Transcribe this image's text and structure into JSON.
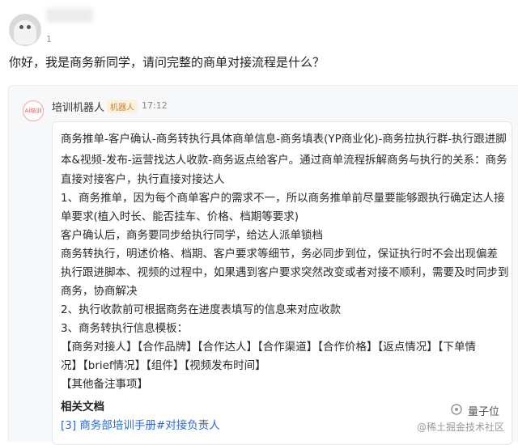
{
  "user_message": {
    "time": "1",
    "text": "你好，我是商务新同学，请问完整的商单对接流程是什么？"
  },
  "bot": {
    "avatar_text": "Ai培训",
    "name": "培训机器人",
    "tag": "机器人",
    "time": "17:12",
    "lines": [
      "商务推单-客户确认-商务转执行具体商单信息-商务填表(YP商业化)-商务拉执行群-执行跟进脚",
      "本&视频-发布-运营找达人收款-商务返点给客户。通过商单流程拆解商务与执行的关系：商务",
      "直接对接客户，执行直接对接达人",
      "1、商务推单，因为每个商单客户的需求不一，所以商务推单前尽量要能够跟执行确定达人接",
      "单要求(植入时长、能否挂车、价格、档期等要求)",
      "客户确认后，商务要同步给执行同学，给达人派单锁档",
      "商务转执行，明述价格、档期、客户要求等细节，务必同步到位，保证执行时不会出现偏差",
      "执行跟进脚本、视频的过程中，如果遇到客户要求突然改变或者对接不顺利，需要及时同步到",
      "商务，协商解决",
      "2、执行收款前可根据商务在进度表填写的信息来对应收款",
      "3、商务转执行信息模板：",
      "【商务对接人】【合作品牌】【合作达人】【合作渠道】【合作价格】【返点情况】【下单情",
      "况】【brief情况】【组件】【视频发布时间】",
      "【其他备注事项】"
    ],
    "refs_heading": "相关文档",
    "ref": {
      "num": "[3]",
      "text": "商务部培训手册#对接负责人"
    }
  },
  "watermark": {
    "brand": "量子位",
    "site": "@稀土掘金技术社区"
  }
}
